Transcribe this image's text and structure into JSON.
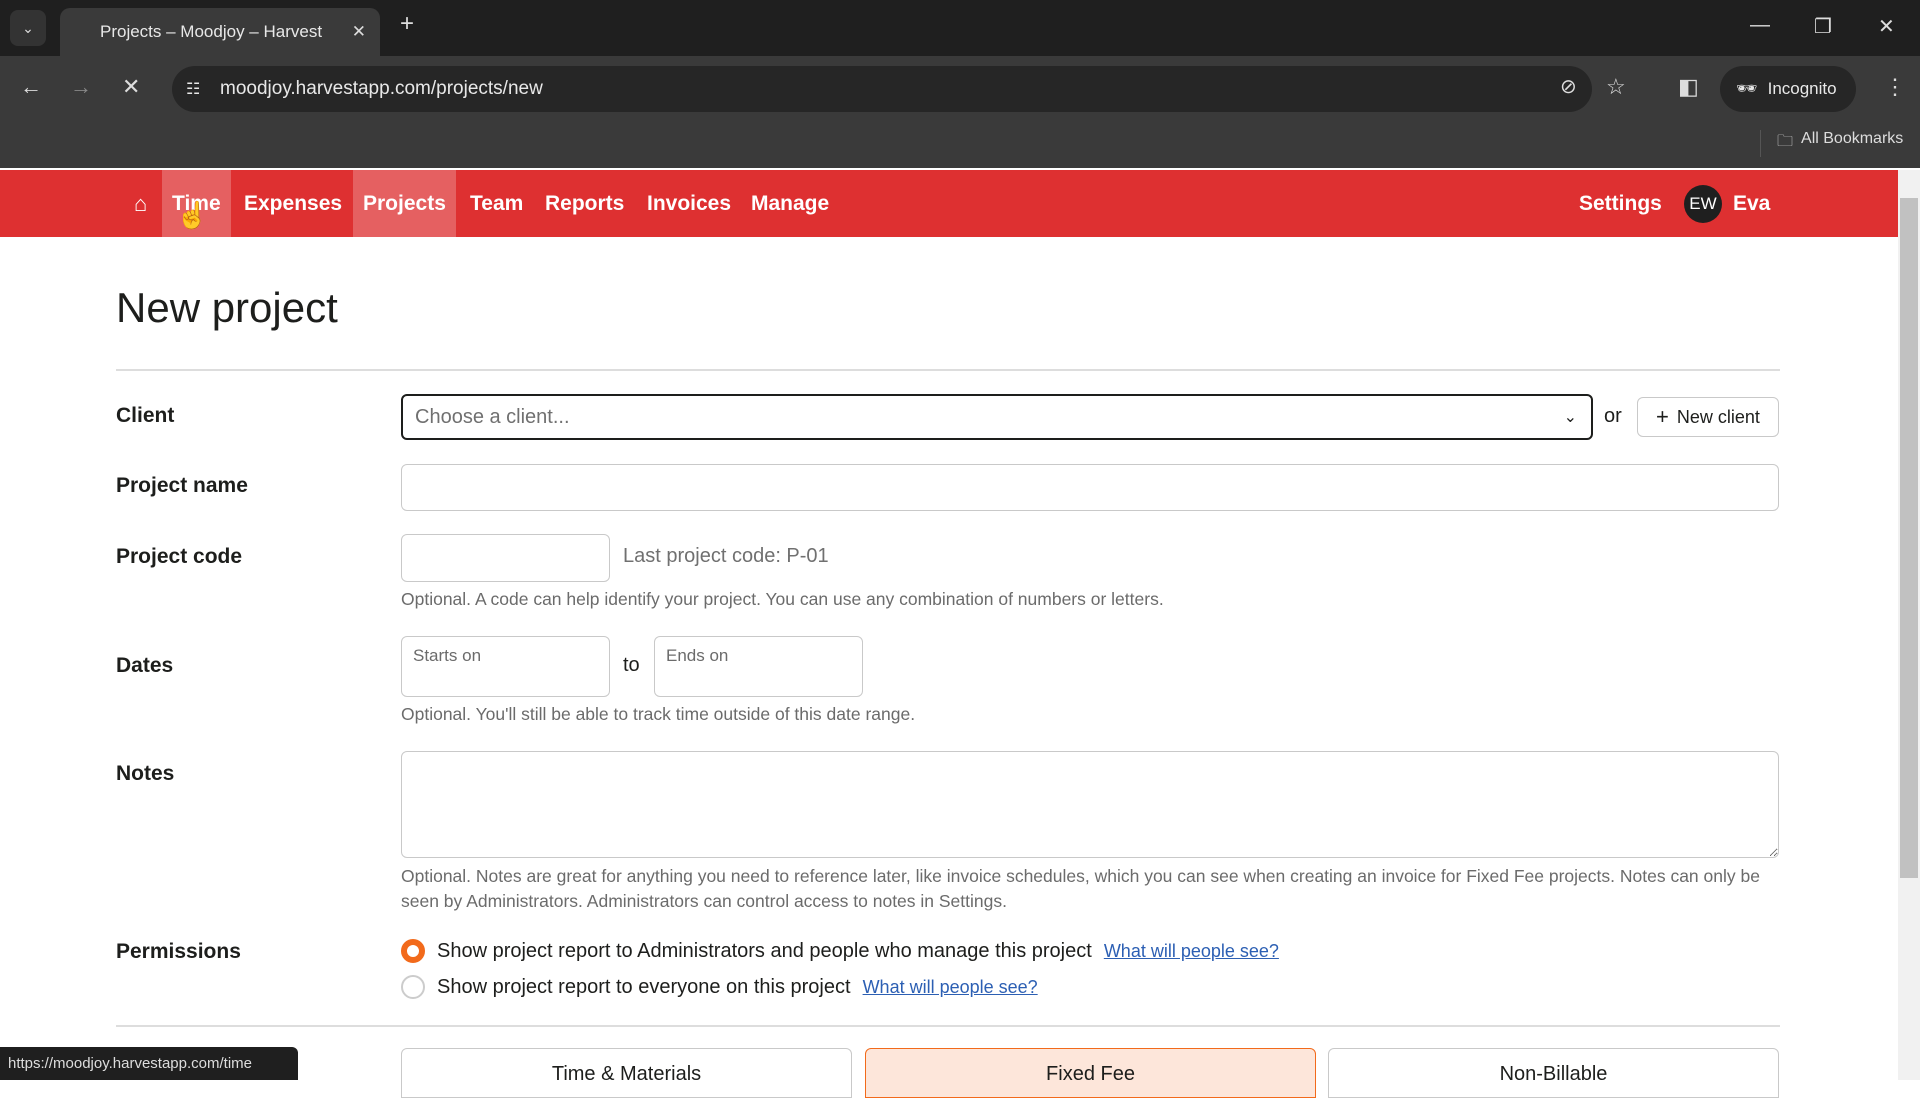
{
  "browser": {
    "tab_title": "Projects – Moodjoy – Harvest",
    "url": "moodjoy.harvestapp.com/projects/new",
    "incognito": "Incognito",
    "bookmarks": "All Bookmarks",
    "status_url": "https://moodjoy.harvestapp.com/time"
  },
  "nav": {
    "items": [
      {
        "label": "Time"
      },
      {
        "label": "Expenses"
      },
      {
        "label": "Projects"
      },
      {
        "label": "Team"
      },
      {
        "label": "Reports"
      },
      {
        "label": "Invoices"
      },
      {
        "label": "Manage"
      }
    ],
    "settings": "Settings",
    "avatar_initials": "EW",
    "user": "Eva",
    "active": "Projects",
    "brand_color": "#de3031"
  },
  "page": {
    "title": "New project"
  },
  "form": {
    "client": {
      "label": "Client",
      "placeholder": "Choose a client...",
      "or": "or",
      "new_client": "New client"
    },
    "project_name": {
      "label": "Project name",
      "value": ""
    },
    "project_code": {
      "label": "Project code",
      "value": "",
      "last_code": "Last project code: P-01",
      "help": "Optional. A code can help identify your project. You can use any combination of numbers or letters."
    },
    "dates": {
      "label": "Dates",
      "starts": "Starts on",
      "to": "to",
      "ends": "Ends on",
      "help": "Optional. You'll still be able to track time outside of this date range."
    },
    "notes": {
      "label": "Notes",
      "value": "",
      "help": "Optional. Notes are great for anything you need to reference later, like invoice schedules, which you can see when creating an invoice for Fixed Fee projects. Notes can only be seen by Administrators. Administrators can control access to notes in Settings."
    },
    "permissions": {
      "label": "Permissions",
      "options": [
        {
          "label": "Show project report to Administrators and people who manage this project",
          "link": "What will people see?",
          "selected": true
        },
        {
          "label": "Show project report to everyone on this project",
          "link": "What will people see?",
          "selected": false
        }
      ]
    },
    "project_types": [
      {
        "label": "Time & Materials"
      },
      {
        "label": "Fixed Fee",
        "selected": true
      },
      {
        "label": "Non-Billable"
      }
    ]
  }
}
